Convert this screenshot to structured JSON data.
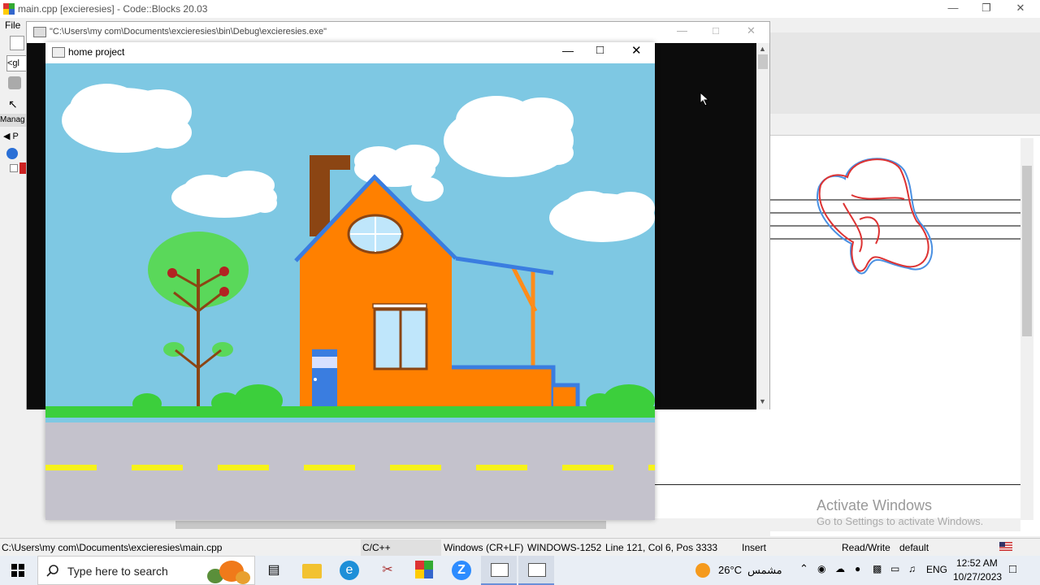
{
  "codeblocks": {
    "title": "main.cpp [excieresies] - Code::Blocks 20.03",
    "menu_file": "File",
    "left_panel": {
      "tab": "Manag",
      "projects": "P",
      "combo": "<gl"
    }
  },
  "console": {
    "title": "\"C:\\Users\\my  com\\Documents\\excieresies\\bin\\Debug\\excieresies.exe\""
  },
  "home_window": {
    "title": "home project"
  },
  "status_bar": {
    "path": "C:\\Users\\my  com\\Documents\\excieresies\\main.cpp",
    "language": "C/C++",
    "line_ending": "Windows (CR+LF)",
    "encoding": "WINDOWS-1252",
    "position": "Line 121, Col 6, Pos 3333",
    "mode": "Insert",
    "access": "Read/Write",
    "profile": "default"
  },
  "watermark": {
    "line1": "Activate Windows",
    "line2": "Go to Settings to activate Windows."
  },
  "taskbar": {
    "search_placeholder": "Type here to search",
    "weather_temp": "26°C",
    "weather_text": "مشمس",
    "language": "ENG",
    "time": "12:52 AM",
    "date": "10/27/2023"
  },
  "colors": {
    "sky": "#7ec8e3",
    "grass": "#3ccf3c",
    "road": "#c4c2cc",
    "lane": "#f6f21b",
    "house": "#ff8000",
    "roof_edge": "#3a7de0",
    "chimney": "#8b4513",
    "tree_leaves": "#5ad85a",
    "trunk": "#8b4513",
    "fruit": "#b22222"
  }
}
